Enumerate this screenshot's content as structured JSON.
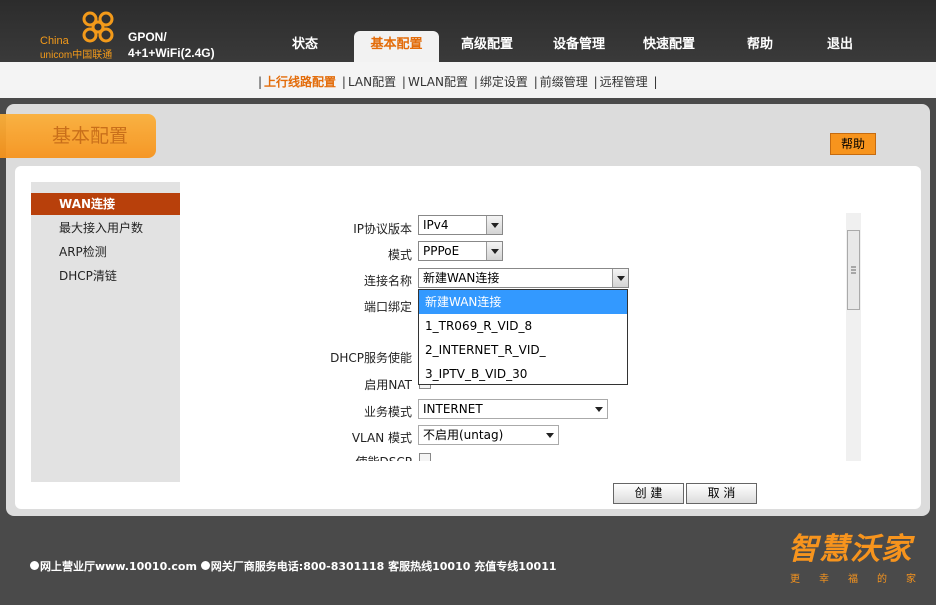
{
  "header": {
    "logo_china": "China",
    "logo_unicom": "unicom中国联通",
    "product_line1": "GPON/",
    "product_line2": "4+1+WiFi(2.4G)",
    "nav": [
      {
        "label": "状态"
      },
      {
        "label": "基本配置"
      },
      {
        "label": "高级配置"
      },
      {
        "label": "设备管理"
      },
      {
        "label": "快速配置"
      },
      {
        "label": "帮助"
      },
      {
        "label": "退出"
      }
    ]
  },
  "subnav": {
    "items": [
      {
        "label": "上行线路配置"
      },
      {
        "label": "LAN配置"
      },
      {
        "label": "WLAN配置"
      },
      {
        "label": "绑定设置"
      },
      {
        "label": "前缀管理"
      },
      {
        "label": "远程管理"
      }
    ],
    "separator": "|"
  },
  "section": {
    "title": "基本配置",
    "help_label": "帮助"
  },
  "left_menu": {
    "items": [
      {
        "label": "WAN连接"
      },
      {
        "label": "最大接入用户数"
      },
      {
        "label": "ARP检测"
      },
      {
        "label": "DHCP清链"
      }
    ]
  },
  "form": {
    "ip_version": {
      "label": "IP协议版本",
      "value": "IPv4"
    },
    "mode": {
      "label": "模式",
      "value": "PPPoE"
    },
    "connection_name": {
      "label": "连接名称",
      "value": "新建WAN连接"
    },
    "port_binding": {
      "label": "端口绑定"
    },
    "dhcp_server": {
      "label": "DHCP服务使能"
    },
    "enable_nat": {
      "label": "启用NAT"
    },
    "service_mode": {
      "label": "业务模式",
      "value": "INTERNET"
    },
    "vlan_mode": {
      "label": "VLAN 模式",
      "value": "不启用(untag)"
    },
    "enable_dscp": {
      "label": "使能DSCP"
    }
  },
  "dropdown": {
    "options": [
      {
        "label": "新建WAN连接"
      },
      {
        "label": "1_TR069_R_VID_8"
      },
      {
        "label": "2_INTERNET_R_VID_"
      },
      {
        "label": "3_IPTV_B_VID_30"
      }
    ]
  },
  "actions": {
    "create": "创 建",
    "cancel": "取 消"
  },
  "footer": {
    "text1": "网上营业厅www.10010.com",
    "text2": "网关厂商服务电话:800-8301118 客服热线10010 充值专线10011",
    "brand": "智慧沃家",
    "slogan": "更幸福的家"
  },
  "colors": {
    "accent": "#f7941d",
    "active_menu": "#b8400b",
    "selected_option": "#3399ff"
  }
}
